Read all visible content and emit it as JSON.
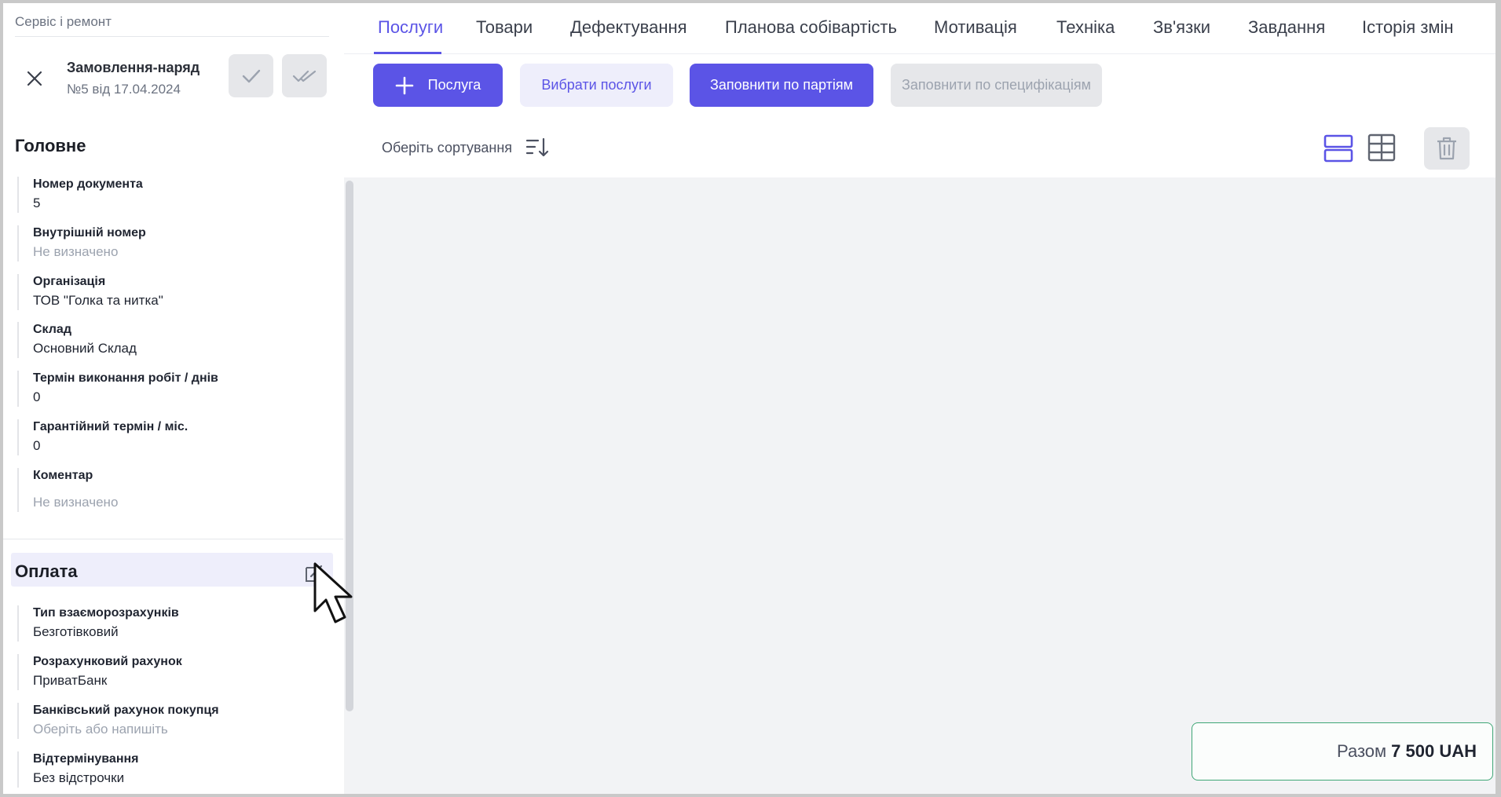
{
  "breadcrumb": "Сервіс і ремонт",
  "document": {
    "title": "Замовлення-наряд",
    "subtitle": "№5 від 17.04.2024"
  },
  "sections": {
    "main": {
      "title": "Головне",
      "fields": [
        {
          "label": "Номер документа",
          "value": "5"
        },
        {
          "label": "Внутрішній номер",
          "value": "Не визначено"
        },
        {
          "label": "Організація",
          "value": "ТОВ \"Голка та нитка\""
        },
        {
          "label": "Склад",
          "value": "Основний Склад"
        },
        {
          "label": "Термін виконання робіт / днів",
          "value": "0"
        },
        {
          "label": "Гарантійний термін / міс.",
          "value": "0"
        },
        {
          "label": "Коментар",
          "value": "Не визначено"
        }
      ]
    },
    "payment": {
      "title": "Оплата",
      "fields": [
        {
          "label": "Тип взаєморозрахунків",
          "value": "Безготівковий"
        },
        {
          "label": "Розрахунковий рахунок",
          "value": "ПриватБанк"
        },
        {
          "label": "Банківський рахунок покупця",
          "value": "Оберіть або напишіть"
        },
        {
          "label": "Відтермінування",
          "value": "Без відстрочки"
        }
      ]
    }
  },
  "tabs": [
    {
      "label": "Послуги",
      "active": true
    },
    {
      "label": "Товари"
    },
    {
      "label": "Дефектування"
    },
    {
      "label": "Планова собівартість"
    },
    {
      "label": "Мотивація"
    },
    {
      "label": "Техніка"
    },
    {
      "label": "Зв'язки"
    },
    {
      "label": "Завдання"
    },
    {
      "label": "Історія змін"
    }
  ],
  "toolbar": {
    "add_service": "Послуга",
    "choose_services": "Вибрати послуги",
    "fill_by_batches": "Заповнити по партіям",
    "fill_by_specs": "Заповнити по специфікаціям",
    "sort_label": "Оберіть сортування"
  },
  "total": {
    "label": "Разом",
    "amount": "7 500 UAH"
  },
  "colors": {
    "accent": "#5b54e6",
    "accent_light": "#eeeefb",
    "total_border": "#3fa676"
  }
}
